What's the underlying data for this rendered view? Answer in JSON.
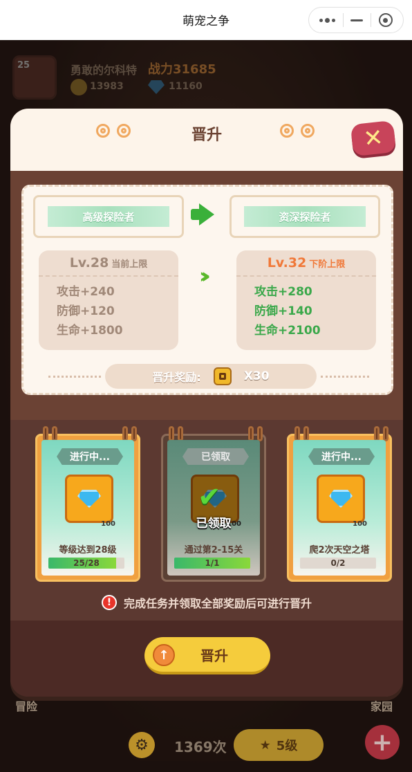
{
  "topbar": {
    "title": "萌宠之争"
  },
  "background": {
    "player_level": "25",
    "player_name": "勇敢的尔科特",
    "power_label": "战力",
    "power_value": "31685",
    "coins": "13983",
    "gems": "11160",
    "left_label": "冒险",
    "right_label": "家园",
    "count_text": "1369次",
    "level_text": "5级"
  },
  "popup": {
    "title": "晋升",
    "current_rank": "高级探险者",
    "next_rank": "资深探险者",
    "current": {
      "level": "Lv.28",
      "limit_label": "当前上限",
      "attack": "攻击+240",
      "defense": "防御+120",
      "hp": "生命+1800"
    },
    "next": {
      "level": "Lv.32",
      "limit_label": "下阶上限",
      "attack": "攻击+280",
      "defense": "防御+140",
      "hp": "生命+2100"
    },
    "reward_label": "晋升奖励:",
    "reward_qty": "X30"
  },
  "tasks": [
    {
      "state": "进行中...",
      "amount": "100",
      "desc": "等级达到28级",
      "progress_text": "25/28",
      "progress": 0.89,
      "done": false
    },
    {
      "state": "已领取",
      "amount": "100",
      "desc": "通过第2-15关",
      "progress_text": "1/1",
      "progress": 1.0,
      "done": true,
      "claimed_text": "已领取"
    },
    {
      "state": "进行中...",
      "amount": "100",
      "desc": "爬2次天空之塔",
      "progress_text": "0/2",
      "progress": 0.0,
      "done": false
    }
  ],
  "warning": "完成任务并领取全部奖励后可进行晋升",
  "promote_button": "晋升",
  "colors": {
    "accent": "#f5cc3c",
    "green": "#3aa84a",
    "orange": "#f07838",
    "close": "#c8445a"
  }
}
